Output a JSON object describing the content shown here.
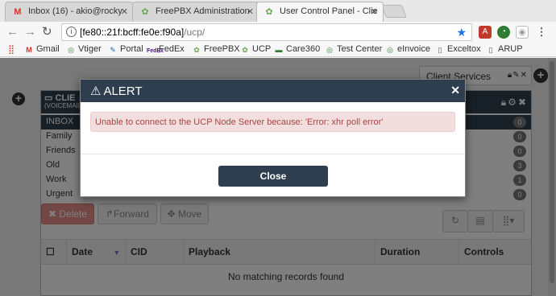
{
  "browser": {
    "tabs": [
      {
        "label": "Inbox (16) - akio@rocky",
        "favicon": "M",
        "favicon_color": "#d93025"
      },
      {
        "label": "FreePBX Administration",
        "favicon": "✿",
        "favicon_color": "#6aa84f"
      },
      {
        "label": "User Control Panel - Clie",
        "favicon": "✿",
        "favicon_color": "#6aa84f"
      }
    ],
    "url_host": "[fe80::21f:bcff:fe0e:f90a]",
    "url_path": "/ucp/",
    "bookmarks": [
      {
        "label": "Apps",
        "icon": "apps-grid-icon"
      },
      {
        "label": "Gmail",
        "icon": "gmail-icon"
      },
      {
        "label": "Vtiger",
        "icon": "vtiger-icon"
      },
      {
        "label": "Portal",
        "icon": "portal-icon"
      },
      {
        "label": "FedEx",
        "icon": "fedex-icon"
      },
      {
        "label": "FreePBX",
        "icon": "freepbx-icon"
      },
      {
        "label": "UCP",
        "icon": "ucp-icon"
      },
      {
        "label": "Care360",
        "icon": "care360-icon"
      },
      {
        "label": "Test Center",
        "icon": "test-center-icon"
      },
      {
        "label": "eInvoice",
        "icon": "einvoice-icon"
      },
      {
        "label": "Exceltox",
        "icon": "page-icon"
      },
      {
        "label": "ARUP",
        "icon": "page-icon"
      }
    ]
  },
  "page": {
    "client_services_label": "Client Services",
    "widget_title": "CLIE",
    "widget_subtitle": "(VOICEMAIL)",
    "folders": [
      {
        "label": "INBOX",
        "count": "0"
      },
      {
        "label": "Family",
        "count": "0"
      },
      {
        "label": "Friends",
        "count": "0"
      },
      {
        "label": "Old",
        "count": "3"
      },
      {
        "label": "Work",
        "count": "1"
      },
      {
        "label": "Urgent",
        "count": "0"
      }
    ],
    "buttons": {
      "delete": "✖ Delete",
      "forward": "Forward",
      "move": "✥ Move"
    },
    "columns": {
      "date": "Date",
      "cid": "CID",
      "playback": "Playback",
      "duration": "Duration",
      "controls": "Controls"
    },
    "empty_message": "No matching records found"
  },
  "modal": {
    "title": "ALERT",
    "message": "Unable to connect to the UCP Node Server because: 'Error: xhr poll error'",
    "close_label": "Close"
  },
  "colors": {
    "header_bg": "#2f3e4e",
    "alert_bg": "#f2dede",
    "alert_text": "#a94442"
  }
}
